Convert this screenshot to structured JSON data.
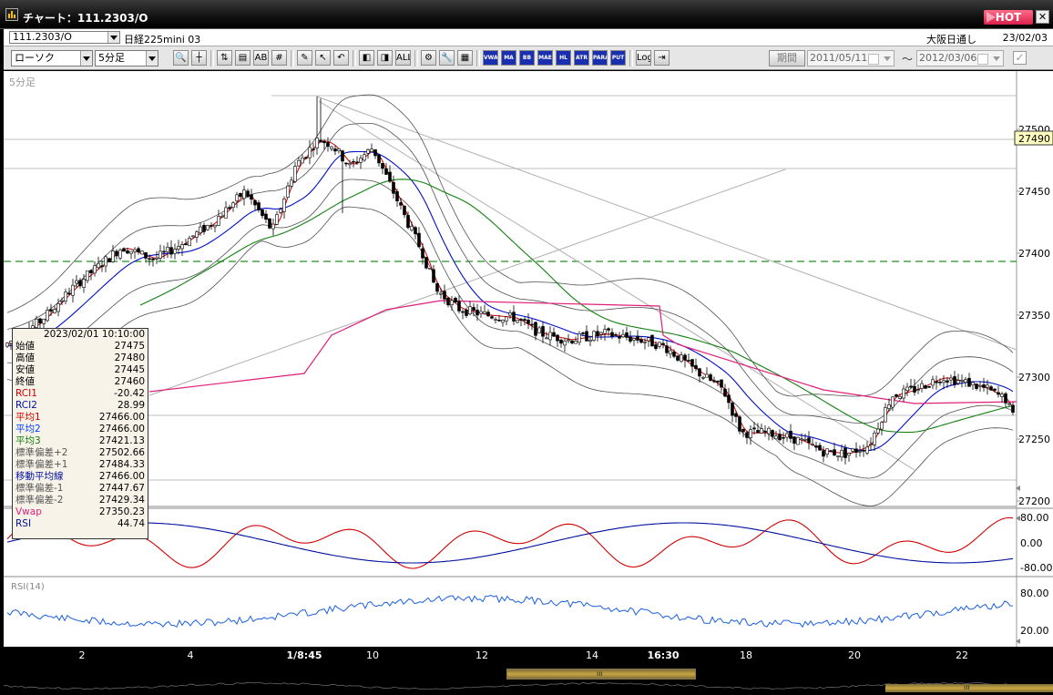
{
  "window": {
    "title": "チャート：111.2303/O",
    "hot_label": "HOT",
    "close_label": "✕"
  },
  "symbol_bar": {
    "symbol_code": "111.2303/O",
    "symbol_name": "日経225mini 03",
    "exchange": "大阪日通し",
    "date": "23/02/03"
  },
  "toolbar": {
    "chart_type": "ローソク",
    "interval": "5分足",
    "period_button": "期間",
    "date_from": "2011/05/11",
    "date_to": "2012/03/06",
    "range_separator": "〜",
    "buttons_group1": [
      {
        "name": "zoom-icon",
        "glyph": "🔍"
      },
      {
        "name": "crosshair-icon",
        "glyph": "┼"
      }
    ],
    "buttons_group2": [
      {
        "name": "up-down-icon",
        "glyph": "⇅"
      },
      {
        "name": "scale-icon",
        "glyph": "▤"
      },
      {
        "name": "chart-ab-icon",
        "glyph": "AB"
      },
      {
        "name": "number-icon",
        "glyph": "#"
      }
    ],
    "buttons_group3": [
      {
        "name": "pen-icon",
        "glyph": "✎"
      },
      {
        "name": "pointer-icon",
        "glyph": "↖"
      },
      {
        "name": "undo-icon",
        "glyph": "↶"
      }
    ],
    "buttons_group4": [
      {
        "name": "candle-left-icon",
        "glyph": "◧"
      },
      {
        "name": "candle-right-icon",
        "glyph": "◨"
      },
      {
        "name": "all-icon",
        "glyph": "ALL"
      }
    ],
    "buttons_group5": [
      {
        "name": "settings-icon",
        "glyph": "⚙"
      },
      {
        "name": "wrench-icon",
        "glyph": "🔧"
      },
      {
        "name": "palette-icon",
        "glyph": "▦"
      }
    ],
    "indicator_buttons": [
      "VWAP",
      "MA",
      "BB",
      "MAE",
      "HL",
      "ATR",
      "PARA",
      "PUT"
    ],
    "buttons_group7": [
      {
        "name": "log-icon",
        "glyph": "Log"
      },
      {
        "name": "export-icon",
        "glyph": "⇥"
      }
    ]
  },
  "chart": {
    "interval_label": "5分足",
    "price_axis": [
      "27500",
      "27450",
      "27400",
      "27350",
      "27300",
      "27250",
      "27200"
    ],
    "current_price": "27490",
    "osc_axis": [
      "80.00",
      "0.00",
      "-80.00"
    ],
    "rsi_axis": [
      "80.00",
      "20.00"
    ],
    "rsi_label": "RSI(14)",
    "x_labels": [
      {
        "t": "2",
        "bold": false
      },
      {
        "t": "4",
        "bold": false
      },
      {
        "t": "1/8:45",
        "bold": true
      },
      {
        "t": "10",
        "bold": false
      },
      {
        "t": "12",
        "bold": false
      },
      {
        "t": "14",
        "bold": false
      },
      {
        "t": "16:30",
        "bold": true
      },
      {
        "t": "18",
        "bold": false
      },
      {
        "t": "20",
        "bold": false
      },
      {
        "t": "22",
        "bold": false
      }
    ],
    "colors": {
      "candle": "#000000",
      "ma1": "#d00000",
      "ma2": "#0010c8",
      "ma3": "#108010",
      "bollinger": "#505050",
      "vwap": "#e0207a",
      "dashed_line": "#209020",
      "rci1": "#d00000",
      "rci2": "#0010a0",
      "rsi": "#1a5fe0"
    }
  },
  "info_panel": {
    "datetime": "2023/02/01  10:10:00",
    "rows": [
      {
        "label": "始値",
        "value": "27475",
        "color": "#000000"
      },
      {
        "label": "高値",
        "value": "27480",
        "color": "#000000"
      },
      {
        "label": "安値",
        "value": "27445",
        "color": "#000000"
      },
      {
        "label": "終値",
        "value": "27460",
        "color": "#000000"
      },
      {
        "label": "RCI1",
        "value": "-20.42",
        "color": "#d00000"
      },
      {
        "label": "RCI2",
        "value": "28.99",
        "color": "#0010a0"
      },
      {
        "label": "平均1",
        "value": "27466.00",
        "color": "#d00000"
      },
      {
        "label": "平均2",
        "value": "27466.00",
        "color": "#0040ff"
      },
      {
        "label": "平均3",
        "value": "27421.13",
        "color": "#108010"
      },
      {
        "label": "標準偏差+2",
        "value": "27502.66",
        "color": "#555555"
      },
      {
        "label": "標準偏差+1",
        "value": "27484.33",
        "color": "#555555"
      },
      {
        "label": "移動平均線",
        "value": "27466.00",
        "color": "#0010a0"
      },
      {
        "label": "標準偏差-1",
        "value": "27447.67",
        "color": "#555555"
      },
      {
        "label": "標準偏差-2",
        "value": "27429.34",
        "color": "#555555"
      },
      {
        "label": "Vwap",
        "value": "27350.23",
        "color": "#e0207a"
      },
      {
        "label": "RSI",
        "value": "44.74",
        "color": "#0010a0"
      }
    ]
  },
  "scrollbar": {
    "grip": "ııı"
  }
}
